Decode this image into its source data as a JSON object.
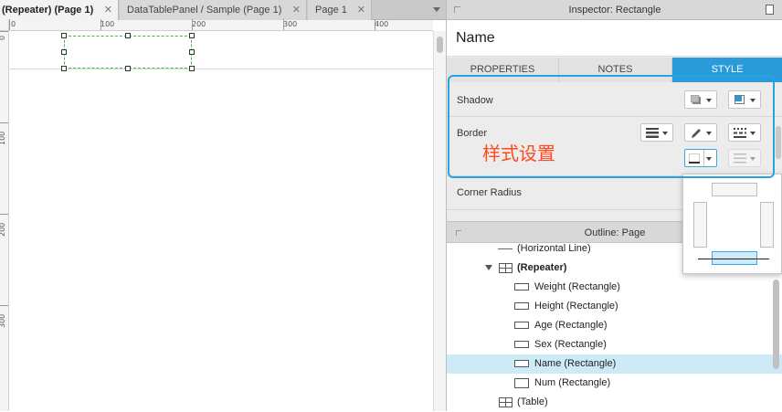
{
  "tabs": [
    {
      "label": "(Repeater) (Page 1)",
      "close": "✕",
      "active": true
    },
    {
      "label": "DataTablePanel / Sample (Page 1)",
      "close": "✕",
      "active": false
    },
    {
      "label": "Page 1",
      "close": "✕",
      "active": false
    }
  ],
  "ruler": {
    "h_labels": [
      "0",
      "100",
      "200",
      "300",
      "400"
    ],
    "v_labels": [
      "0",
      "100",
      "200",
      "300"
    ]
  },
  "inspector": {
    "title": "Inspector: Rectangle",
    "name": "Name",
    "tabs": [
      "PROPERTIES",
      "NOTES",
      "STYLE"
    ],
    "active_tab": "STYLE",
    "shadow_label": "Shadow",
    "border_label": "Border",
    "corner_radius_label": "Corner Radius",
    "annotation": "样式设置"
  },
  "outline": {
    "title": "Outline: Page",
    "items": [
      {
        "label": "(Horizontal Line)",
        "icon": "horizontal-line-icon"
      },
      {
        "label": "(Repeater)",
        "icon": "repeater-icon",
        "bold": true,
        "expanded": true
      },
      {
        "label": "Weight (Rectangle)",
        "icon": "rectangle-icon"
      },
      {
        "label": "Height (Rectangle)",
        "icon": "rectangle-icon"
      },
      {
        "label": "Age (Rectangle)",
        "icon": "rectangle-icon"
      },
      {
        "label": "Sex (Rectangle)",
        "icon": "rectangle-icon"
      },
      {
        "label": "Name (Rectangle)",
        "icon": "rectangle-icon",
        "selected": true
      },
      {
        "label": "Num (Rectangle)",
        "icon": "rectangle-icon"
      },
      {
        "label": "(Table)",
        "icon": "table-icon"
      }
    ]
  },
  "colors": {
    "accent": "#2b9ad9",
    "annotation": "#ff4a1c",
    "selection_dashed": "#3fbf3f",
    "outline_selected": "#cdeaf7"
  }
}
